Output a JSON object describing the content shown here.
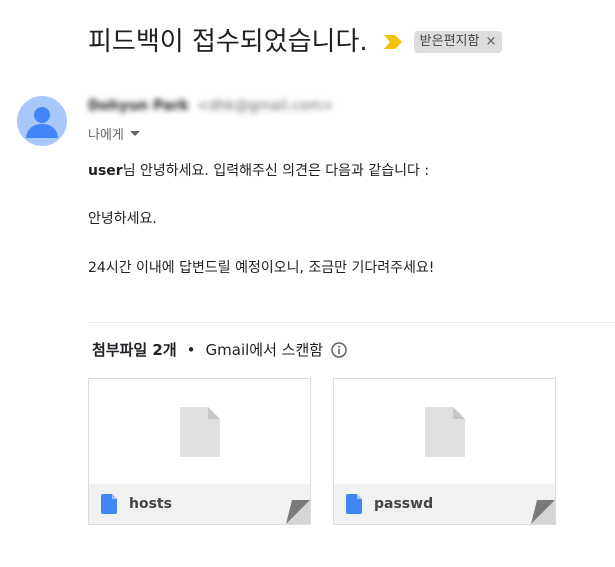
{
  "email": {
    "subject": "피드백이 접수되었습니다.",
    "label": "받은편지함",
    "label_close": "×",
    "sender_name": "Dohyun Park",
    "sender_email": "<dhk@gmail.com>",
    "recipient": "나에게",
    "body": {
      "username": "user",
      "line1_rest": "님 안녕하세요. 입력해주신 의견은 다음과 같습니다 :",
      "line2": "안녕하세요.",
      "line3": "24시간 이내에 답변드릴 예정이오니, 조금만 기다려주세요!"
    }
  },
  "attachments": {
    "title": "첨부파일 2개",
    "dot": "•",
    "scan_note": "Gmail에서 스캔함",
    "files": [
      {
        "name": "hosts"
      },
      {
        "name": "passwd"
      }
    ]
  },
  "colors": {
    "importance_marker": "#f4c20d",
    "avatar_bg": "#a8c7fa",
    "avatar_fg": "#4285f4",
    "file_icon": "#4285f4"
  },
  "icons": {
    "importance": "importance-marker-icon",
    "info": "info-icon",
    "file": "doc-file-icon",
    "preview": "file-preview-icon",
    "caret": "chevron-down-icon",
    "avatar": "person-avatar-icon"
  }
}
